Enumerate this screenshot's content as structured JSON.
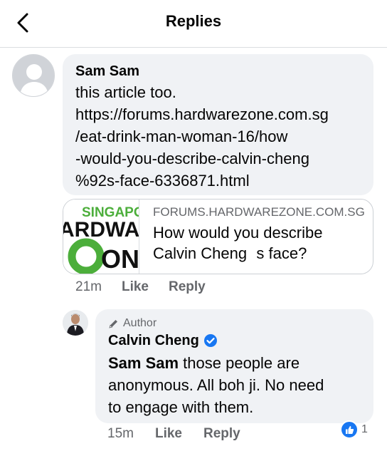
{
  "header": {
    "title": "Replies",
    "back_icon": "chevron-left-icon"
  },
  "comment": {
    "author": "Sam Sam",
    "text": "this article too. https://forums.hardwarezone.com.sg /eat-drink-man-woman-16/how -would-you-describe-calvin-cheng %92s-face-6336871.html",
    "text_lines": [
      "this article too.",
      "https://forums.hardwarezone.com.sg",
      "/eat-drink-man-woman-16/how",
      "-would-you-describe-calvin-cheng",
      "%92s-face-6336871.html"
    ],
    "link_preview": {
      "thumb_lines": [
        "SINGAPO",
        "ARDWAR",
        "ONE"
      ],
      "domain": "FORUMS.HARDWAREZONE.COM.SG",
      "title_lines": [
        "How would you describe",
        "Calvin Chengs face?"
      ]
    },
    "time": "21m",
    "like_label": "Like",
    "reply_label": "Reply"
  },
  "reply": {
    "badge": "Author",
    "author": "Calvin Cheng",
    "mention": "Sam Sam",
    "text_first": " those people are",
    "text_lines": [
      "anonymous. All boh ji. No need",
      "to engage with them."
    ],
    "time": "15m",
    "like_label": "Like",
    "reply_label": "Reply",
    "reaction_count": "1"
  },
  "colors": {
    "accent": "#1877f2",
    "bubble": "#f0f2f5",
    "brand_green": "#4cae3b"
  }
}
